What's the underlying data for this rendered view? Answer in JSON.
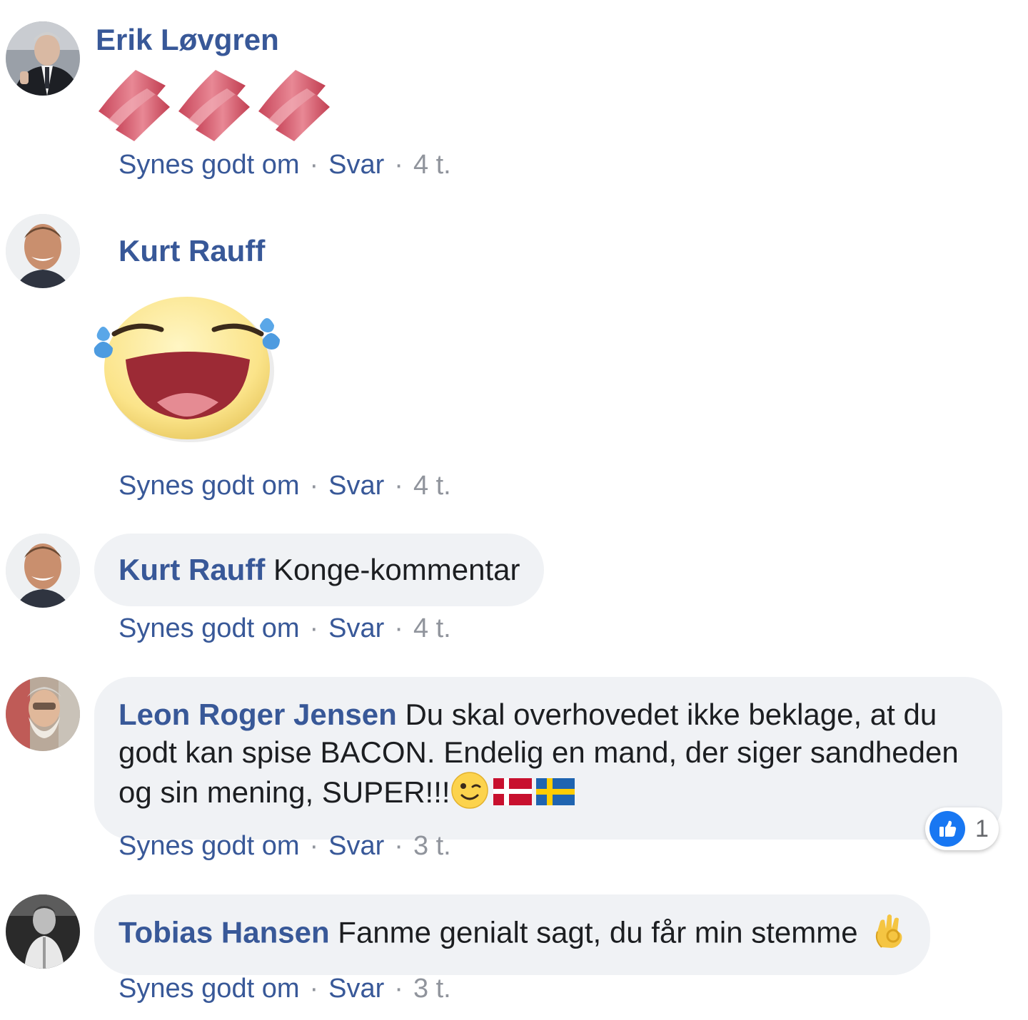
{
  "actions": {
    "like": "Synes godt om",
    "reply": "Svar",
    "separator": "·"
  },
  "comments": [
    {
      "author": "Erik Løvgren",
      "text": "",
      "sticker": "bacon-strips",
      "time": "4 t."
    },
    {
      "author": "Kurt Rauff",
      "text": "",
      "sticker": "laughing-tears-sticker",
      "time": "4 t."
    },
    {
      "author": "Kurt Rauff",
      "text": "Konge-kommentar",
      "time": "4 t."
    },
    {
      "author": "Leon Roger Jensen",
      "text_line1": "Du skal overhovedet ikke beklage, at du",
      "text_line2": "godt kan spise BACON. Endelig en mand, der siger sandheden",
      "text_line3": "og sin mening, SUPER!!!",
      "emojis": [
        "wink-face",
        "flag-denmark",
        "flag-sweden"
      ],
      "reaction": {
        "type": "like",
        "count": "1"
      },
      "time": "3 t."
    },
    {
      "author": "Tobias Hansen",
      "text": "Fanme genialt sagt, du får min stemme",
      "emojis": [
        "ok-hand"
      ],
      "time": "3 t."
    }
  ],
  "colors": {
    "name": "#385898",
    "meta": "#90949c",
    "bubble": "#f0f2f5",
    "like": "#1877f2"
  }
}
